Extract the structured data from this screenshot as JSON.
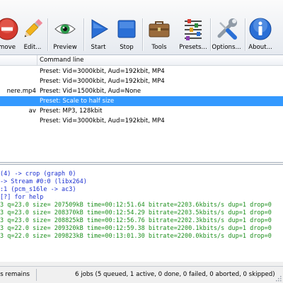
{
  "toolbar": {
    "remove_label": "move",
    "edit_label": "Edit...",
    "preview_label": "Preview",
    "start_label": "Start",
    "stop_label": "Stop",
    "tools_label": "Tools",
    "presets_label": "Presets...",
    "options_label": "Options...",
    "about_label": "About..."
  },
  "table": {
    "column_header": "Command line",
    "rows": [
      {
        "col1": "",
        "col2": "Preset: Vid=3000kbit, Aud=192kbit, MP4"
      },
      {
        "col1": "",
        "col2": "Preset: Vid=3000kbit, Aud=192kbit, MP4"
      },
      {
        "col1": "nere.mp4",
        "col2": "Preset: Vid=1500kbit, Aud=None"
      },
      {
        "col1": "",
        "col2": "Preset: Scale to half size"
      },
      {
        "col1": "av",
        "col2": "Preset: MP3, 128kbit"
      },
      {
        "col1": "",
        "col2": "Preset: Vid=3000kbit, Aud=192kbit, MP4"
      }
    ]
  },
  "log": {
    "lines": [
      "(4) -> crop (graph 0)",
      "-> Stream #0:0 (libx264)",
      ":1 (pcm_s16le -> ac3)",
      "[?] for help",
      "3 q=23.0 size=  207509kB time=00:12:51.64 bitrate=2203.6kbits/s dup=1 drop=0",
      "3 q=23.0 size=  208370kB time=00:12:54.29 bitrate=2203.5kbits/s dup=1 drop=0",
      "3 q=23.0 size=  208825kB time=00:12:56.76 bitrate=2202.3kbits/s dup=1 drop=0",
      "3 q=22.0 size=  209320kB time=00:12:59.38 bitrate=2200.1kbits/s dup=1 drop=0",
      "3 q=22.0 size=  209823kB time=00:13:01.30 bitrate=2200.0kbits/s dup=1 drop=0"
    ]
  },
  "status": {
    "left": "nds remains",
    "right": "6 jobs (5 queued, 1 active, 0 done, 0 failed, 0 aborted, 0 skipped)"
  },
  "colors": {
    "selection": "#3399ff",
    "log_blue": "#1b2fd0",
    "log_green": "#1d8f1d"
  }
}
